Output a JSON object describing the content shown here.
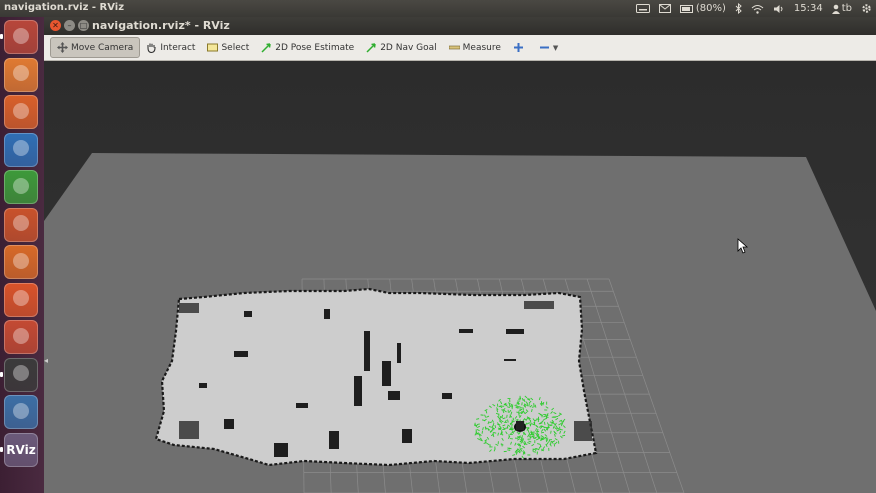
{
  "top_panel": {
    "app_title": "navigation.rviz - RViz",
    "battery": "(80%)",
    "clock": "15:34",
    "user": "tb",
    "icons": [
      "keyboard-icon",
      "mail-icon",
      "battery-icon",
      "bluetooth-icon",
      "wifi-icon",
      "volume-icon",
      "user-icon",
      "gear-icon"
    ]
  },
  "window": {
    "title": "navigation.rviz* - RViz"
  },
  "launcher": {
    "items": [
      {
        "name": "dash-icon",
        "color": "#b8473a"
      },
      {
        "name": "files-icon",
        "color": "#e07a32"
      },
      {
        "name": "firefox-icon",
        "color": "#d9602a"
      },
      {
        "name": "writer-icon",
        "color": "#2f6fb5"
      },
      {
        "name": "calc-icon",
        "color": "#3d9a3a"
      },
      {
        "name": "impress-icon",
        "color": "#c9522b"
      },
      {
        "name": "software-center-icon",
        "color": "#d86a28"
      },
      {
        "name": "ubuntu-one-icon",
        "color": "#d9532a"
      },
      {
        "name": "system-settings-icon",
        "color": "#c44a33"
      },
      {
        "name": "terminal-icon",
        "color": "#3b3b3b"
      },
      {
        "name": "python-icon",
        "color": "#3c6fa6"
      },
      {
        "name": "rviz-icon",
        "color": "#6b5a7a",
        "label": "RViz"
      }
    ]
  },
  "toolbar": {
    "move_camera": "Move Camera",
    "interact": "Interact",
    "select": "Select",
    "pose_estimate": "2D Pose Estimate",
    "nav_goal": "2D Nav Goal",
    "measure": "Measure"
  },
  "colors": {
    "particles": "#2ecc2e",
    "map_free": "#cdcdcd",
    "floor": "#6e6e6e"
  }
}
